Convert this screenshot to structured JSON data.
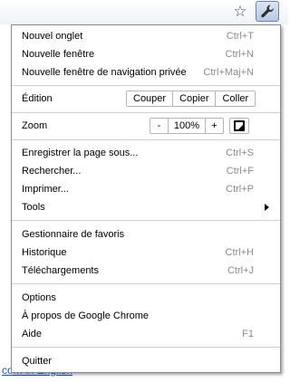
{
  "toolbar": {
    "star_icon": "star-icon",
    "wrench_icon": "wrench-icon"
  },
  "background": {
    "link_text": "com in English"
  },
  "menu": {
    "new_tab": {
      "label": "Nouvel onglet",
      "shortcut": "Ctrl+T"
    },
    "new_window": {
      "label": "Nouvelle fenêtre",
      "shortcut": "Ctrl+N"
    },
    "new_incognito": {
      "label": "Nouvelle fenêtre de navigation privée",
      "shortcut": "Ctrl+Maj+N"
    },
    "edit": {
      "label": "Édition",
      "cut": "Couper",
      "copy": "Copier",
      "paste": "Coller"
    },
    "zoom": {
      "label": "Zoom",
      "minus": "-",
      "value": "100%",
      "plus": "+"
    },
    "save_page": {
      "label": "Enregistrer la page sous...",
      "shortcut": "Ctrl+S"
    },
    "find": {
      "label": "Rechercher...",
      "shortcut": "Ctrl+F"
    },
    "print": {
      "label": "Imprimer...",
      "shortcut": "Ctrl+P"
    },
    "tools": {
      "label": "Tools"
    },
    "bookmarks": {
      "label": "Gestionnaire de favoris"
    },
    "history": {
      "label": "Historique",
      "shortcut": "Ctrl+H"
    },
    "downloads": {
      "label": "Téléchargements",
      "shortcut": "Ctrl+J"
    },
    "options": {
      "label": "Options"
    },
    "about": {
      "label": "À propos de Google Chrome"
    },
    "help": {
      "label": "Aide",
      "shortcut": "F1"
    },
    "quit": {
      "label": "Quitter"
    }
  }
}
